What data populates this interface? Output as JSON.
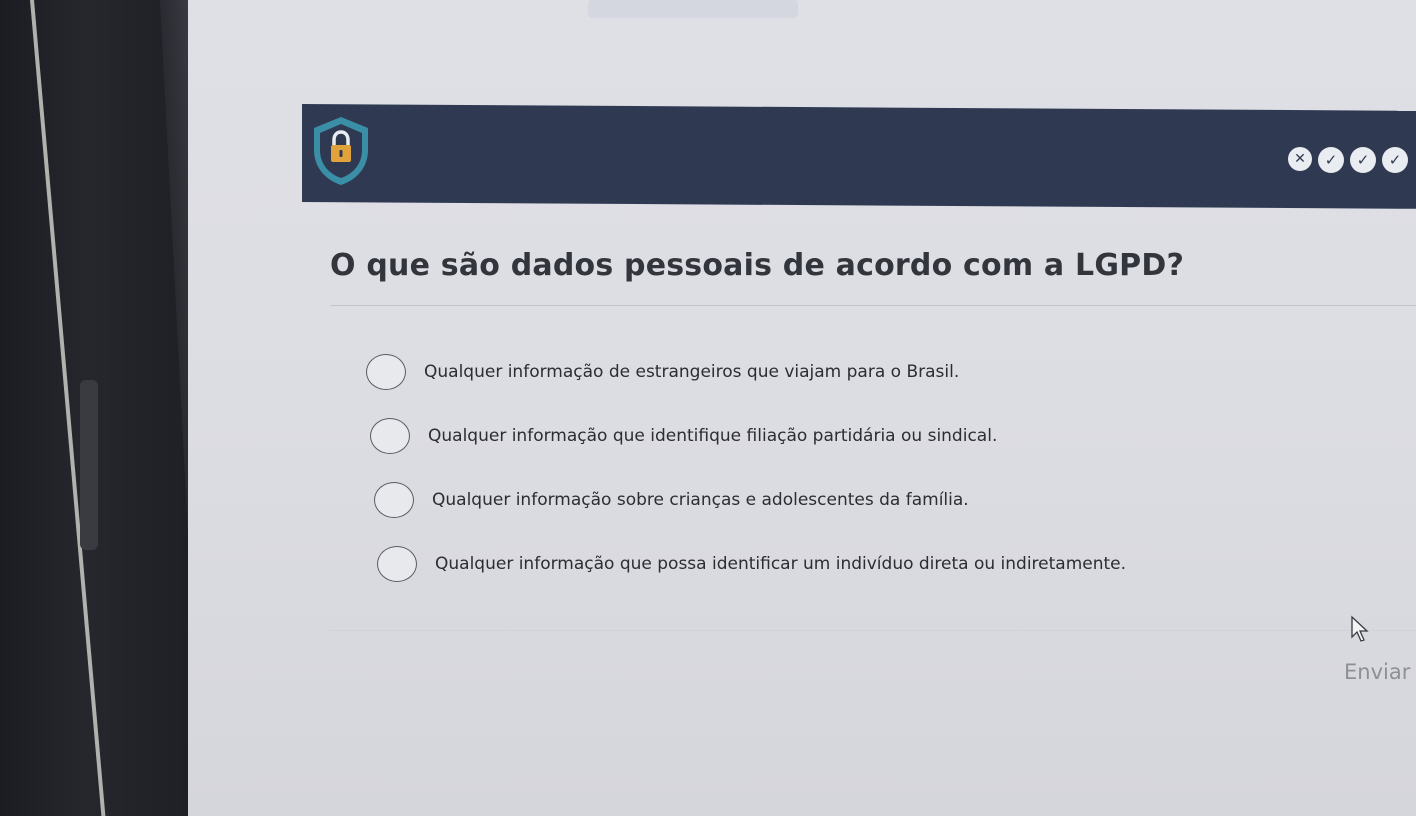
{
  "header": {
    "icon": "shield-lock-icon",
    "progress": [
      {
        "status": "wrong",
        "symbol": "✕"
      },
      {
        "status": "correct",
        "symbol": "✓"
      },
      {
        "status": "correct",
        "symbol": "✓"
      },
      {
        "status": "correct",
        "symbol": "✓"
      }
    ]
  },
  "question": {
    "text": "O que são dados pessoais de acordo com a LGPD?"
  },
  "options": [
    {
      "label": "Qualquer informação de estrangeiros que viajam para o Brasil."
    },
    {
      "label": "Qualquer informação que identifique filiação partidária ou sindical."
    },
    {
      "label": "Qualquer informação sobre crianças e adolescentes da família."
    },
    {
      "label": "Qualquer informação que possa identificar um indivíduo direta ou indiretamente."
    }
  ],
  "submit": {
    "label": "Enviar"
  },
  "colors": {
    "header_bg": "#2f3a52",
    "accent": "#3a8fa6",
    "lock": "#e0a23a"
  }
}
